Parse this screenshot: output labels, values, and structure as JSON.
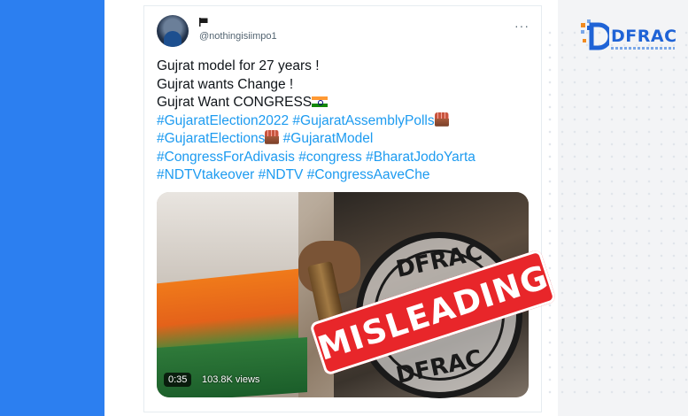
{
  "tweet": {
    "handle": "@nothingisiimpo1",
    "flag_icon": "black-flag-icon",
    "more_icon": "···",
    "lines": [
      "Gujrat model for 27 years !",
      "Gujrat wants Change !",
      "Gujrat Want CONGRESS"
    ],
    "hashtags": {
      "h1": "#GujaratElection2022",
      "h2": "#GujaratAssemblyPolls",
      "h3": "#GujaratElections",
      "h4": "#GujaratModel",
      "h5": "#CongressForAdivasis",
      "h6": "#congress",
      "h7": "#BharatJodoYarta",
      "h8": "#NDTVtakeover",
      "h9": "#NDTV",
      "h10": "#CongressAaveChe"
    }
  },
  "video": {
    "duration": "0:35",
    "views": "103.8K views"
  },
  "stamp": {
    "top_text": "DFRAC",
    "bottom_text": "DFRAC",
    "banner": "MISLEADING"
  },
  "logo": {
    "text": "DFRAC"
  },
  "colors": {
    "hashtag": "#1d9bf0",
    "band": "#2c7ff0",
    "banner": "#e8262a",
    "logo": "#1f63d6"
  }
}
